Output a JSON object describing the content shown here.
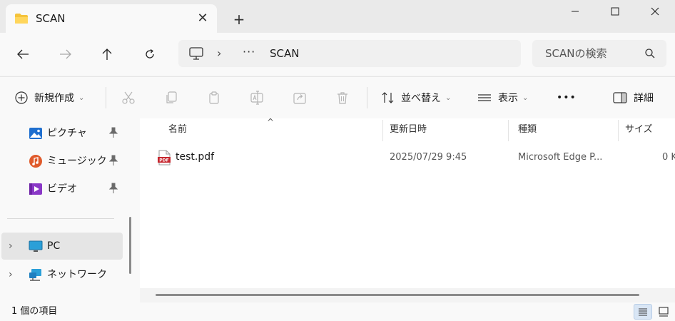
{
  "window": {
    "tab_title": "SCAN",
    "tab_close": "✕",
    "new_tab": "+"
  },
  "nav": {
    "address_separator": "›",
    "address_more": "···",
    "address_current": "SCAN",
    "search_placeholder": "SCANの検索"
  },
  "commands": {
    "new": "新規作成",
    "sort": "並べ替え",
    "view": "表示",
    "more": "•••",
    "details": "詳細"
  },
  "sidebar": {
    "quick_access": [
      {
        "label": "ピクチャ"
      },
      {
        "label": "ミュージック"
      },
      {
        "label": "ビデオ"
      }
    ],
    "locations": [
      {
        "label": "PC"
      },
      {
        "label": "ネットワーク"
      }
    ]
  },
  "file_list": {
    "columns": [
      "名前",
      "更新日時",
      "種類",
      "サイズ"
    ],
    "rows": [
      {
        "name": "test.pdf",
        "modified": "2025/07/29 9:45",
        "type": "Microsoft Edge P...",
        "size": "0 K"
      }
    ]
  },
  "status": {
    "item_count": "1 個の項目"
  },
  "colors": {
    "accent": "#0067c0",
    "folder_yellow": "#f5c33b",
    "pdf_red": "#c6262e",
    "selected_row": "#e5e5e5"
  }
}
